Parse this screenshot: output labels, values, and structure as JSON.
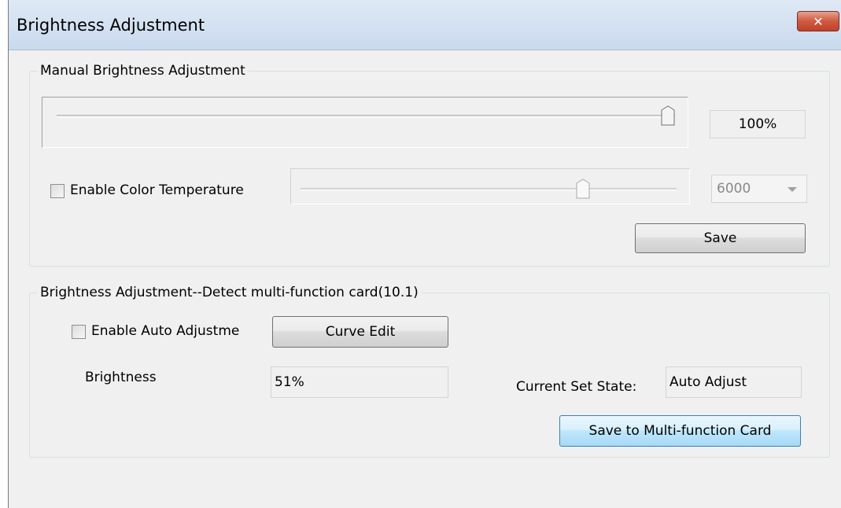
{
  "window": {
    "title": "Brightness Adjustment",
    "close_label": "✕"
  },
  "manual": {
    "group_title": "Manual Brightness Adjustment",
    "brightness_level": 1.0,
    "brightness_value": "100%",
    "color_temp_checkbox_label": "Enable Color Temperature",
    "color_temp_checked": false,
    "color_temp_level": 0.76,
    "color_temp_value": "6000",
    "save_label": "Save"
  },
  "auto": {
    "group_title": "Brightness Adjustment--Detect multi-function card(10.1)",
    "auto_checkbox_label": "Enable Auto Adjustme",
    "auto_checked": false,
    "curve_edit_label": "Curve Edit",
    "brightness_label": "Brightness",
    "brightness_value": "51%",
    "state_label": "Current Set State:",
    "state_value": "Auto Adjust",
    "save_card_label": "Save to Multi-function Card"
  }
}
